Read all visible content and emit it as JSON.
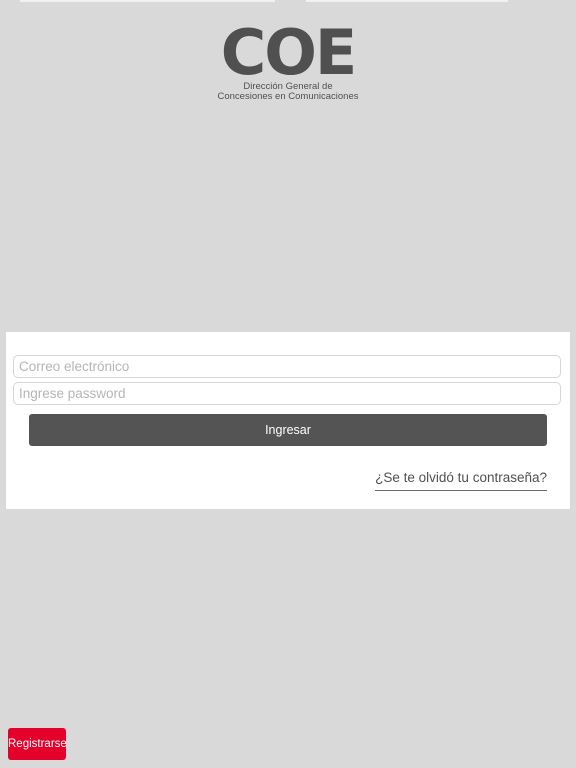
{
  "logo": {
    "mark": "COE",
    "subtitle_line1": "Dirección General de",
    "subtitle_line2": "Concesiones en Comunicaciones"
  },
  "login": {
    "email_placeholder": "Correo electrónico",
    "email_value": "",
    "password_placeholder": "Ingrese password",
    "password_value": "",
    "submit_label": "Ingresar",
    "forgot_password_label": "¿Se te olvidó tu contraseña?"
  },
  "register": {
    "label": "Registrarse"
  },
  "colors": {
    "background": "#d9d9d9",
    "panel": "#ffffff",
    "primary_button": "#545454",
    "register_button": "#e4002b",
    "logo_text": "#505050"
  }
}
